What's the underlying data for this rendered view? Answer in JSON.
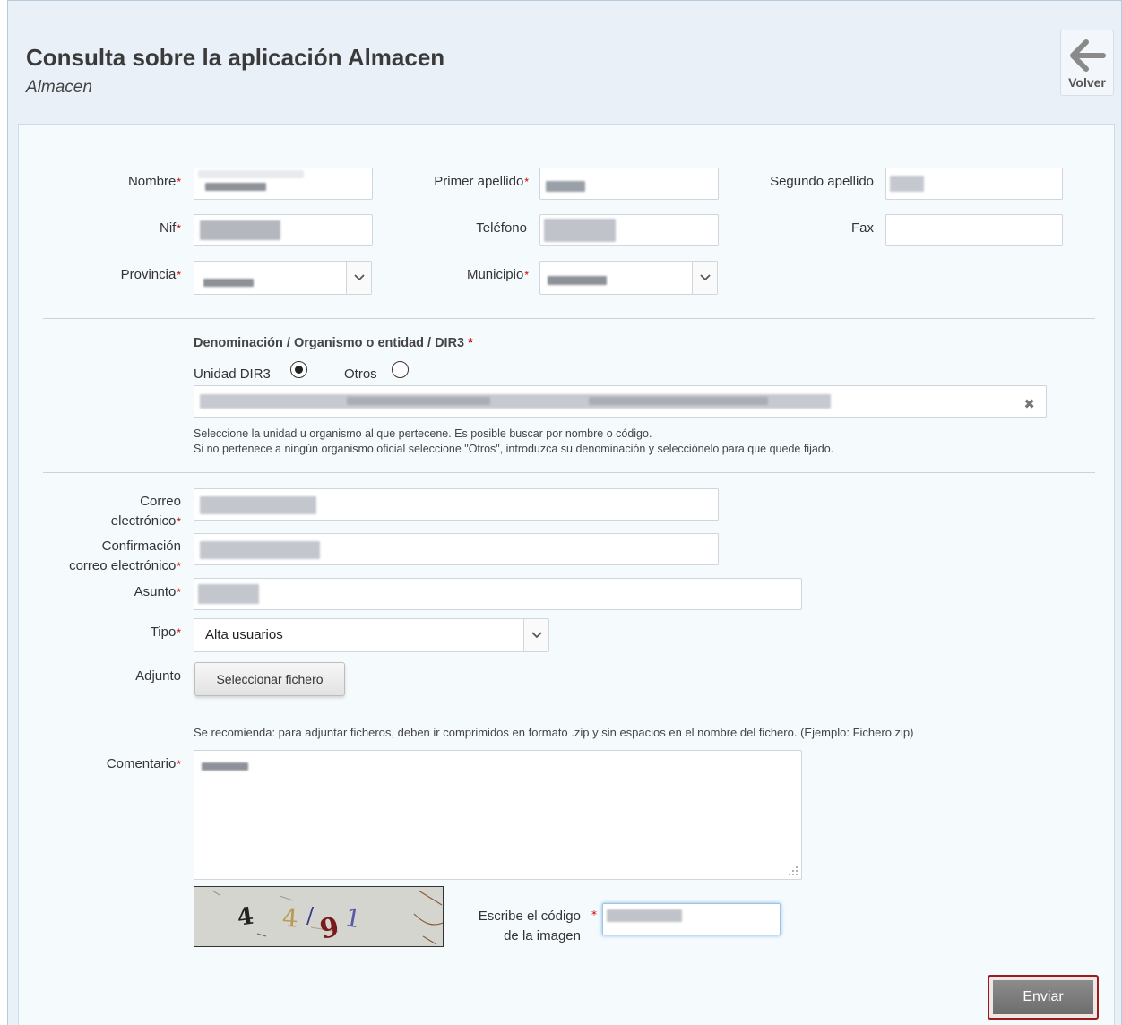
{
  "header": {
    "title": "Consulta sobre la aplicación Almacen",
    "subtitle": "Almacen",
    "back_label": "Volver"
  },
  "form": {
    "nombre_label": "Nombre",
    "primer_apellido_label": "Primer apellido",
    "segundo_apellido_label": "Segundo apellido",
    "nif_label": "Nif",
    "telefono_label": "Teléfono",
    "fax_label": "Fax",
    "provincia_label": "Provincia",
    "municipio_label": "Municipio",
    "required_mark": "*",
    "denominacion": {
      "label": "Denominación / Organismo o entidad / DIR3",
      "options": [
        {
          "label": "Unidad DIR3",
          "selected": true
        },
        {
          "label": "Otros",
          "selected": false
        }
      ],
      "clear_icon": "close-icon",
      "help_line1": "Seleccione la unidad u organismo al que pertecene. Es posible buscar por nombre o código.",
      "help_line2": "Si no pertenece a ningún organismo oficial seleccione \"Otros\", introduzca su denominación y selecciónelo para que quede fijado."
    },
    "correo_label_1": "Correo",
    "correo_label_2": "electrónico",
    "confirmacion_label_1": "Confirmación",
    "confirmacion_label_2": "correo electrónico",
    "asunto_label": "Asunto",
    "tipo_label": "Tipo",
    "tipo_value": "Alta usuarios",
    "adjunto_label": "Adjunto",
    "file_button": "Seleccionar fichero",
    "attach_hint": "Se recomienda: para adjuntar ficheros, deben ir comprimidos en formato .zip y sin espacios en el nombre del fichero. (Ejemplo: Fichero.zip)",
    "comentario_label": "Comentario",
    "captcha_label_1": "Escribe el código",
    "captcha_label_2": "de la imagen",
    "captcha_text": "4 4/91",
    "submit": "Enviar"
  },
  "colors": {
    "required": "#cc0000",
    "submit_border": "#9a1c1c",
    "background": "#e9f0f8"
  }
}
